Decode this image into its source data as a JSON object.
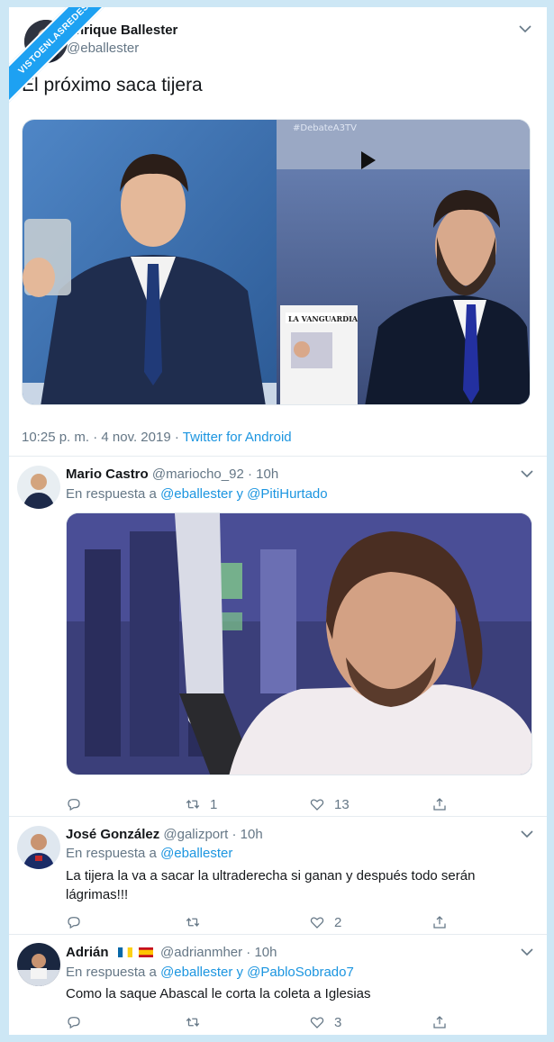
{
  "watermark": "VISTOENLASREDES",
  "main_tweet": {
    "author_name": "Enrique Ballester",
    "author_handle": "@eballester",
    "text": "El próximo saca tijera",
    "media_left_caption": "",
    "media_right_tag": "#DebateA3TV",
    "newspaper_label": "LA VANGUARDIA",
    "timestamp": "10:25 p. m. · 4 nov. 2019 ·",
    "source": "Twitter for Android"
  },
  "replies": [
    {
      "name": "Mario Castro",
      "handle": "@mariocho_92 · 10h",
      "in_reply_prefix": "En respuesta a",
      "mentions": "@eballester y @PitiHurtado",
      "text": "",
      "reply_count": "",
      "retweet_count": "1",
      "like_count": "13"
    },
    {
      "name": "José González",
      "handle": "@galizport · 10h",
      "in_reply_prefix": "En respuesta a",
      "mentions": "@eballester",
      "text": "La tijera la va a sacar la ultraderecha si ganan y después todo serán lágrimas!!!",
      "reply_count": "",
      "retweet_count": "",
      "like_count": "2"
    },
    {
      "name": "Adrián",
      "handle": "@adrianmher · 10h",
      "in_reply_prefix": "En respuesta a",
      "mentions": "@eballester y @PabloSobrado7",
      "text": "Como la saque Abascal le corta la coleta a Iglesias",
      "reply_count": "",
      "retweet_count": "",
      "like_count": "3"
    }
  ],
  "icons": [
    "chevron-down-icon",
    "reply-icon",
    "retweet-icon",
    "like-icon",
    "share-icon"
  ],
  "colors": {
    "link": "#1b95e0",
    "muted": "#657786",
    "background": "#cde7f5"
  }
}
